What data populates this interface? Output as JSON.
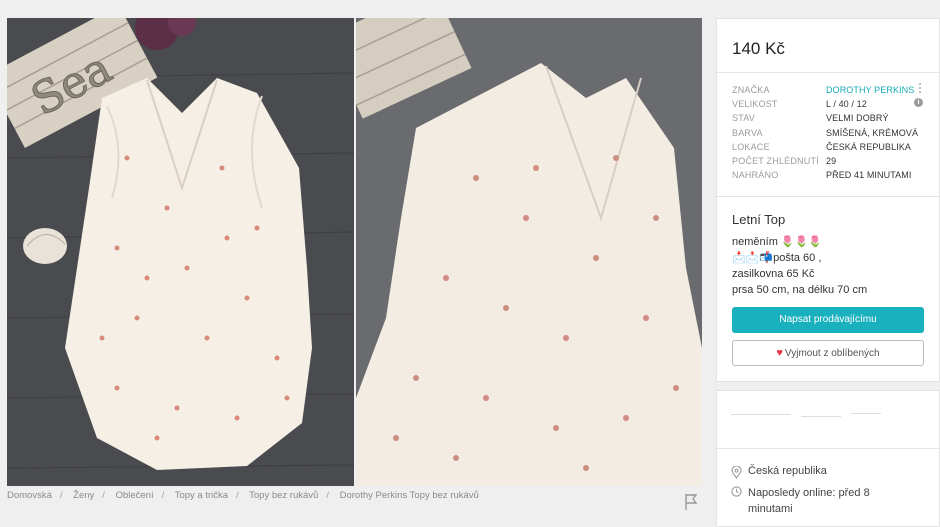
{
  "price": "140 Kč",
  "attributes": [
    {
      "key": "ZNAČKA",
      "value": "DOROTHY PERKINS",
      "link": true
    },
    {
      "key": "VELIKOST",
      "value": "L / 40 / 12",
      "link": false
    },
    {
      "key": "STAV",
      "value": "VELMI DOBRÝ",
      "link": false
    },
    {
      "key": "BARVA",
      "value": "SMÍŠENÁ, KRÉMOVÁ",
      "link": false
    },
    {
      "key": "LOKACE",
      "value": "ČESKÁ REPUBLIKA",
      "link": false
    },
    {
      "key": "POČET ZHLÉDNUTÍ",
      "value": "29",
      "link": false
    },
    {
      "key": "NAHRÁNO",
      "value": "PŘED 41 MINUTAMI",
      "link": false
    }
  ],
  "listing": {
    "title": "Letní Top",
    "description": [
      "neměním 🌷🌷🌷",
      "📩📩📬pošta 60 ,",
      "zasilkovna 65 Kč",
      "prsa 50 cm, na délku 70 cm"
    ]
  },
  "buttons": {
    "message_seller": "Napsat prodávajícímu",
    "favourite": "Vyjmout z oblíbených"
  },
  "seller": {
    "location": "Česká republika",
    "last_online": "Naposledy online: před 8 minutami"
  },
  "breadcrumb": [
    "Domovská",
    "Ženy",
    "Oblečení",
    "Topy a trička",
    "Topy bez rukávů",
    "Dorothy Perkins Topy bez rukávů"
  ],
  "photo_text": "Sea",
  "colors": {
    "accent": "#1ab1bf",
    "brand_link": "#17a9b6",
    "heart": "#e8334a",
    "fabric": "#f6efe6",
    "floor": "#4b4b4f"
  },
  "icons": {
    "location": "map-pin-icon",
    "clock": "clock-icon",
    "flag": "flag-icon",
    "info": "info-icon",
    "menu": "more-vertical-icon",
    "favourite": "heart-icon"
  }
}
